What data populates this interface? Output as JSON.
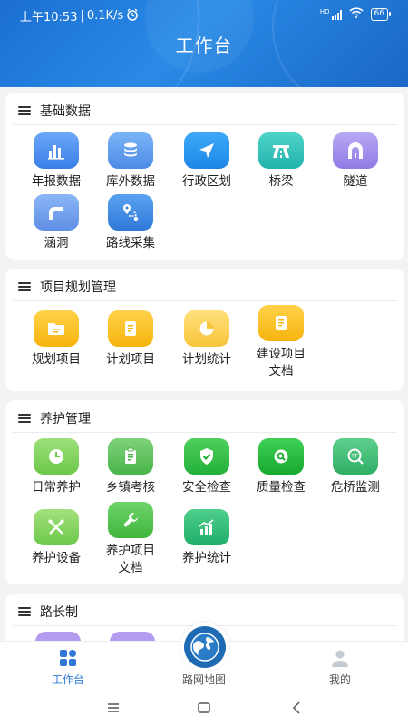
{
  "status": {
    "time": "上午10:53",
    "speed": "0.1K/s",
    "network": "HD",
    "battery": "66"
  },
  "header": {
    "title": "工作台"
  },
  "sections": {
    "basic": {
      "title": "基础数据",
      "items": [
        "年报数据",
        "库外数据",
        "行政区划",
        "桥梁",
        "隧道",
        "涵洞",
        "路线采集"
      ]
    },
    "planning": {
      "title": "项目规划管理",
      "items": [
        "规划项目",
        "计划项目",
        "计划统计",
        "建设项目",
        "文档"
      ]
    },
    "maintenance": {
      "title": "养护管理",
      "items": [
        "日常养护",
        "乡镇考核",
        "安全检查",
        "质量检查",
        "危桥监测",
        "养护设备",
        "养护项目",
        "文档",
        "养护统计"
      ]
    },
    "road_chief": {
      "title": "路长制"
    }
  },
  "tabbar": {
    "workbench": "工作台",
    "map": "路网地图",
    "mine": "我的"
  },
  "colors": {
    "accent": "#2f78d6",
    "header": "#1b6fd1"
  }
}
